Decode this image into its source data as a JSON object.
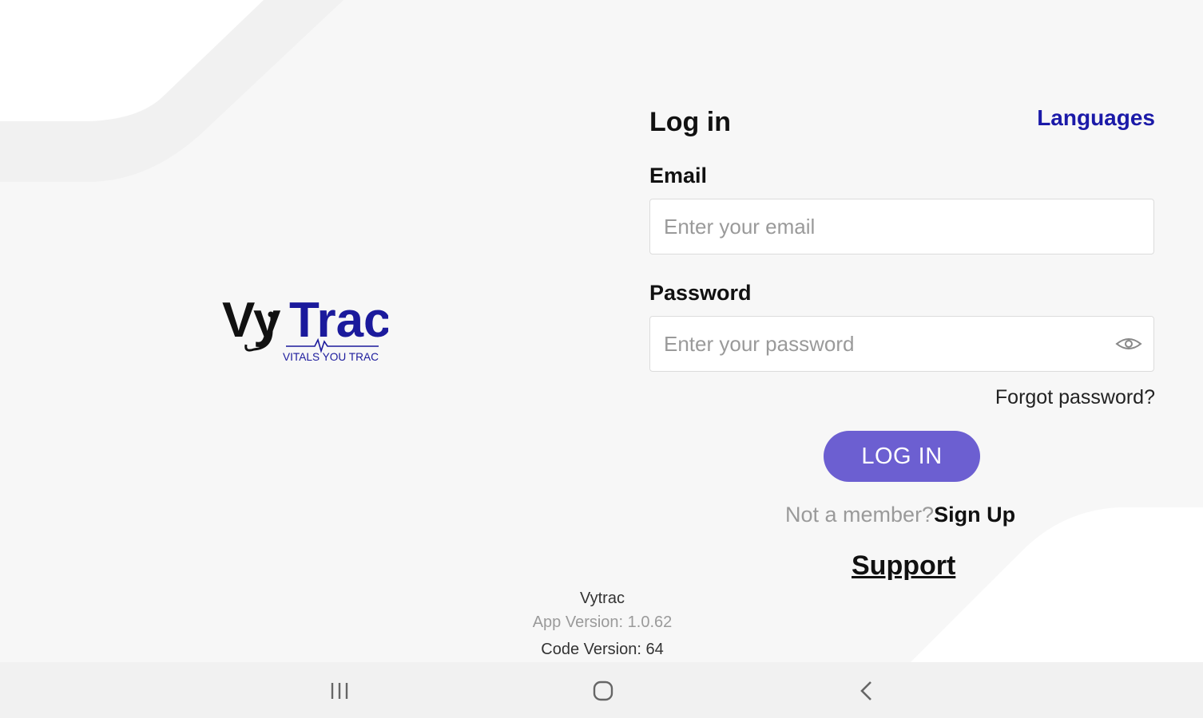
{
  "brand": {
    "logo_main_prefix": "Vy",
    "logo_main_suffix": "Trac",
    "logo_tagline": "VITALS YOU TRAC"
  },
  "login": {
    "title": "Log in",
    "languages_link": "Languages",
    "email_label": "Email",
    "email_placeholder": "Enter your email",
    "email_value": "",
    "password_label": "Password",
    "password_placeholder": "Enter your password",
    "password_value": "",
    "forgot_password": "Forgot password?",
    "login_button": "LOG IN",
    "signup_prefix": "Not a member?",
    "signup_link": "Sign Up",
    "support_link": "Support"
  },
  "footer": {
    "app_name": "Vytrac",
    "app_version": "App Version: 1.0.62",
    "code_version": "Code Version: 64"
  },
  "system_nav": {
    "icons": [
      "recent-apps-icon",
      "home-icon",
      "back-icon"
    ]
  },
  "colors": {
    "accent": "#6c5fd1",
    "link": "#1b1aa8",
    "brand_navy": "#1b1a9c",
    "background": "#f7f7f7"
  }
}
